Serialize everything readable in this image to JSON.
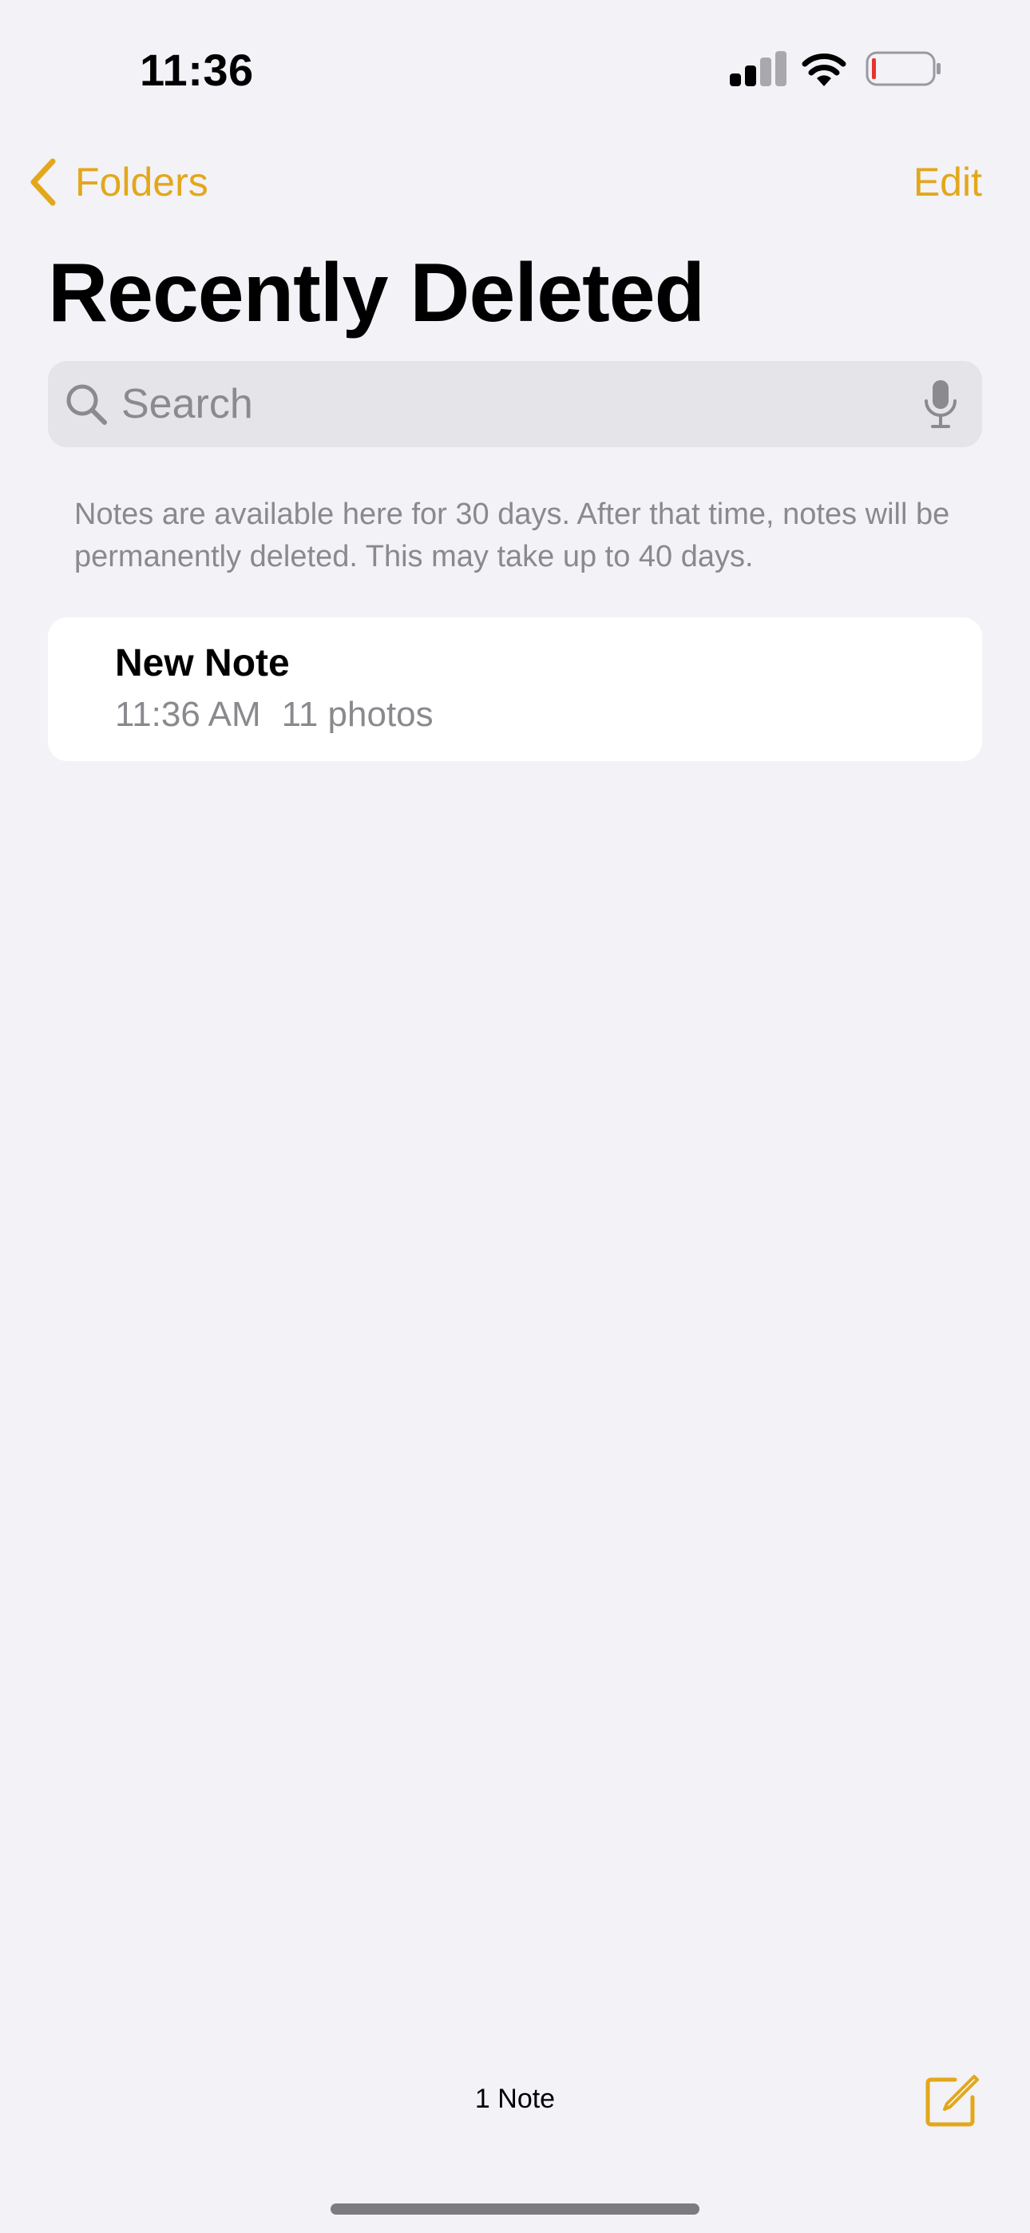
{
  "status_bar": {
    "time": "11:36",
    "signal_icon": "cellular-signal-icon",
    "wifi_icon": "wifi-icon",
    "battery_icon": "battery-low-icon"
  },
  "nav": {
    "back_label": "Folders",
    "back_icon": "chevron-left-icon",
    "edit_label": "Edit"
  },
  "page_title": "Recently Deleted",
  "search": {
    "placeholder": "Search",
    "value": "",
    "icon": "search-icon",
    "mic_icon": "microphone-icon"
  },
  "info_text": "Notes are available here for 30 days. After that time, notes will be permanently deleted. This may take up to 40 days.",
  "notes": [
    {
      "title": "New Note",
      "time": "11:36 AM",
      "detail": "11 photos"
    }
  ],
  "toolbar": {
    "note_count": "1 Note",
    "compose_icon": "compose-icon"
  },
  "colors": {
    "accent": "#E3A71A",
    "background": "#F2F2F7",
    "card": "#FFFFFF",
    "secondary_text": "#8A8A8E",
    "battery_low": "#E5342B"
  }
}
